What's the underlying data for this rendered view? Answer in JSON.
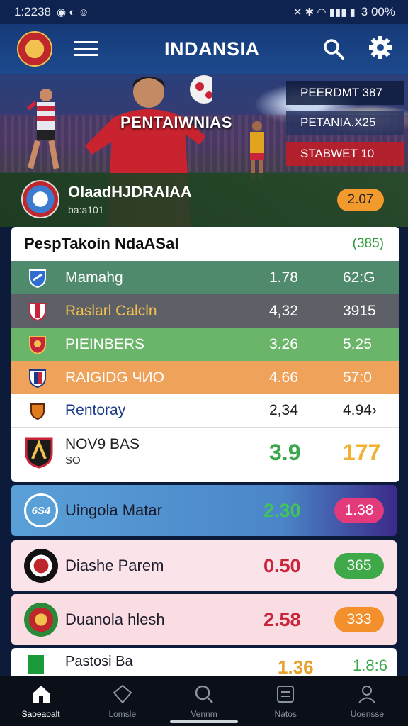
{
  "status_bar": {
    "time": "1:2238",
    "battery": "3 00%"
  },
  "header": {
    "title": "INDANSIA"
  },
  "hero": {
    "banner_text": "PENTAIWNIAS",
    "info_boxes": [
      "PEERDMT 387",
      "PETANIA.X25",
      "STABWET 10"
    ]
  },
  "featured_match": {
    "name": "OlaadHJDRAIAA",
    "sub": "ba:a101",
    "odds": "2.07"
  },
  "table": {
    "title": "PespTakoin NdaASal",
    "count": "(385)",
    "rows": [
      {
        "name": "Mamahg",
        "v1": "1.78",
        "v2": "62:G"
      },
      {
        "name": "Raslarl Calcln",
        "v1": "4,32",
        "v2": "3915"
      },
      {
        "name": "PIEINBERS",
        "v1": "3.26",
        "v2": "5.25"
      },
      {
        "name": "RAIGIDG ЧИО",
        "v1": "4.66",
        "v2": "57:0"
      },
      {
        "name": "Rentoray",
        "v1": "2,34",
        "v2": "4.94›"
      },
      {
        "name": "NOV9 BAS",
        "sub": "SO",
        "v1": "3.9",
        "v2": "177"
      }
    ]
  },
  "cards": [
    {
      "name": "Uingola Matar",
      "badge": "6S4",
      "value": "2.30",
      "pill": "1.38"
    },
    {
      "name": "Diashe Parem",
      "value": "0.50",
      "pill": "365"
    },
    {
      "name": "Duanola hlesh",
      "value": "2.58",
      "pill": "333"
    },
    {
      "name": "Pastosi Ba",
      "value": "1.36",
      "value2": "1.8:6"
    }
  ],
  "bottom_nav": [
    {
      "label": "Saoeaoalt",
      "icon": "home-icon"
    },
    {
      "label": "Lomsle",
      "icon": "shield-icon"
    },
    {
      "label": "Vennm",
      "icon": "search-icon"
    },
    {
      "label": "Natos",
      "icon": "notes-icon"
    },
    {
      "label": "Uoensse",
      "icon": "user-icon"
    }
  ],
  "colors": {
    "header": "#163a78",
    "accent_orange": "#f39a2c",
    "accent_green": "#3fa94a",
    "accent_pink": "#e23a7a"
  }
}
